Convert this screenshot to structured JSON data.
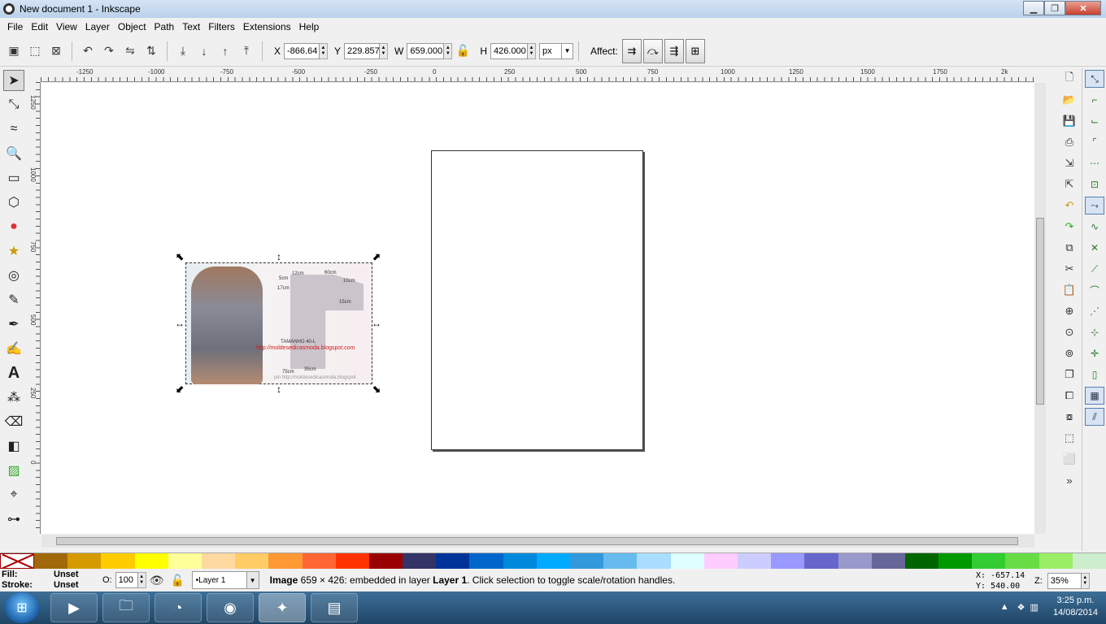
{
  "window": {
    "title": "New document 1 - Inkscape",
    "minimize": "▁",
    "maximize": "❐",
    "close": "✕"
  },
  "menu": [
    "File",
    "Edit",
    "View",
    "Layer",
    "Object",
    "Path",
    "Text",
    "Filters",
    "Extensions",
    "Help"
  ],
  "toolbar": {
    "x_label": "X",
    "x_value": "-866.64",
    "y_label": "Y",
    "y_value": "229.857",
    "w_label": "W",
    "w_value": "659.000",
    "h_label": "H",
    "h_value": "426.000",
    "unit": "px",
    "affect_label": "Affect:"
  },
  "ruler": {
    "h_labels": [
      "-1250",
      "-1000",
      "-750",
      "-500",
      "-250",
      "0",
      "250",
      "500",
      "750",
      "1000",
      "1250",
      "1500",
      "1750",
      "2k"
    ],
    "v_labels": [
      "1250",
      "1000",
      "750",
      "500",
      "250",
      "0"
    ]
  },
  "image": {
    "lines": [
      "12cm",
      "60cm",
      "5cm",
      "10cm",
      "17cm",
      "15cm",
      "TAMANHO 40-L",
      "http://moldesedicasmoda.blogspot.com",
      "75cm",
      "35cm",
      "pin http://moldesedicasmoda.blogspot"
    ]
  },
  "status": {
    "fill_label": "Fill:",
    "fill_value": "Unset",
    "stroke_label": "Stroke:",
    "stroke_value": "Unset",
    "opacity_label": "O:",
    "opacity_value": "100",
    "layer": "•Layer 1",
    "msg_bold": "Image",
    "msg_rest": " 659 × 426: embedded in layer ",
    "msg_layer": "Layer 1",
    "msg_tail": ". Click selection to toggle scale/rotation handles.",
    "coord_x": "X:  -657.14",
    "coord_y": "Y:   540.00",
    "zoom_label": "Z:",
    "zoom_value": "35%"
  },
  "taskbar": {
    "time": "3:25 p.m.",
    "date": "14/08/2014"
  },
  "palette": [
    "#a2690a",
    "#d49a00",
    "#ffcc00",
    "#ffff00",
    "#ffff99",
    "#ffd9a0",
    "#ffcc66",
    "#ff9933",
    "#ff6633",
    "#ff3300",
    "#990000",
    "#333366",
    "#003399",
    "#0066cc",
    "#0088dd",
    "#00aaff",
    "#3399dd",
    "#66bbee",
    "#aaddff",
    "#ddffff",
    "#ffccff",
    "#ccccff",
    "#9999ff",
    "#6666cc",
    "#9999cc",
    "#666699",
    "#006600",
    "#009900",
    "#33cc33",
    "#66dd44",
    "#99ee66",
    "#cceecc"
  ]
}
